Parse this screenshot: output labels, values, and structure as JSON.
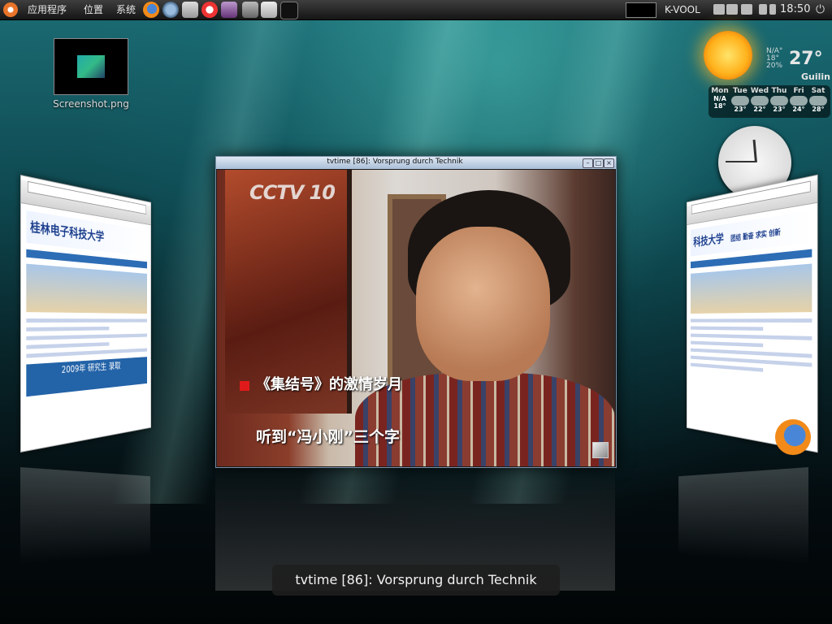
{
  "panel": {
    "menu_apps": "应用程序",
    "menu_places": "位置",
    "menu_system": "系统",
    "username": "K-VOOL",
    "clock": "18:50"
  },
  "desktop": {
    "icon_label": "Screenshot.png"
  },
  "weather": {
    "na_lines": [
      "N/A°",
      "18°",
      "20%"
    ],
    "temperature": "27°",
    "city": "Guilin",
    "forecast": [
      {
        "day": "Mon",
        "temp": "N/A",
        "low": "18°"
      },
      {
        "day": "Tue",
        "temp": "23°"
      },
      {
        "day": "Wed",
        "temp": "22°"
      },
      {
        "day": "Thu",
        "temp": "23°"
      },
      {
        "day": "Fri",
        "temp": "24°"
      },
      {
        "day": "Sat",
        "temp": "28°"
      }
    ]
  },
  "left_window": {
    "site_title": "桂林电子科技大学",
    "banner": "2009年 研究生 录取"
  },
  "right_window": {
    "site_title": "科技大学",
    "motto": "团结 勤奋 求实 创新"
  },
  "tv_window": {
    "title": "tvtime [86]: Vorsprung durch Technik",
    "channel_logo": "CCTV 10",
    "subtitle_top": "《集结号》的激情岁月",
    "subtitle_bottom": "听到“冯小刚”三个字"
  },
  "switcher": {
    "caption": "tvtime [86]: Vorsprung durch Technik"
  },
  "colors": {
    "accent_blue": "#2363a8",
    "subtitle_red": "#e01a1a",
    "panel_dark": "#151515"
  }
}
